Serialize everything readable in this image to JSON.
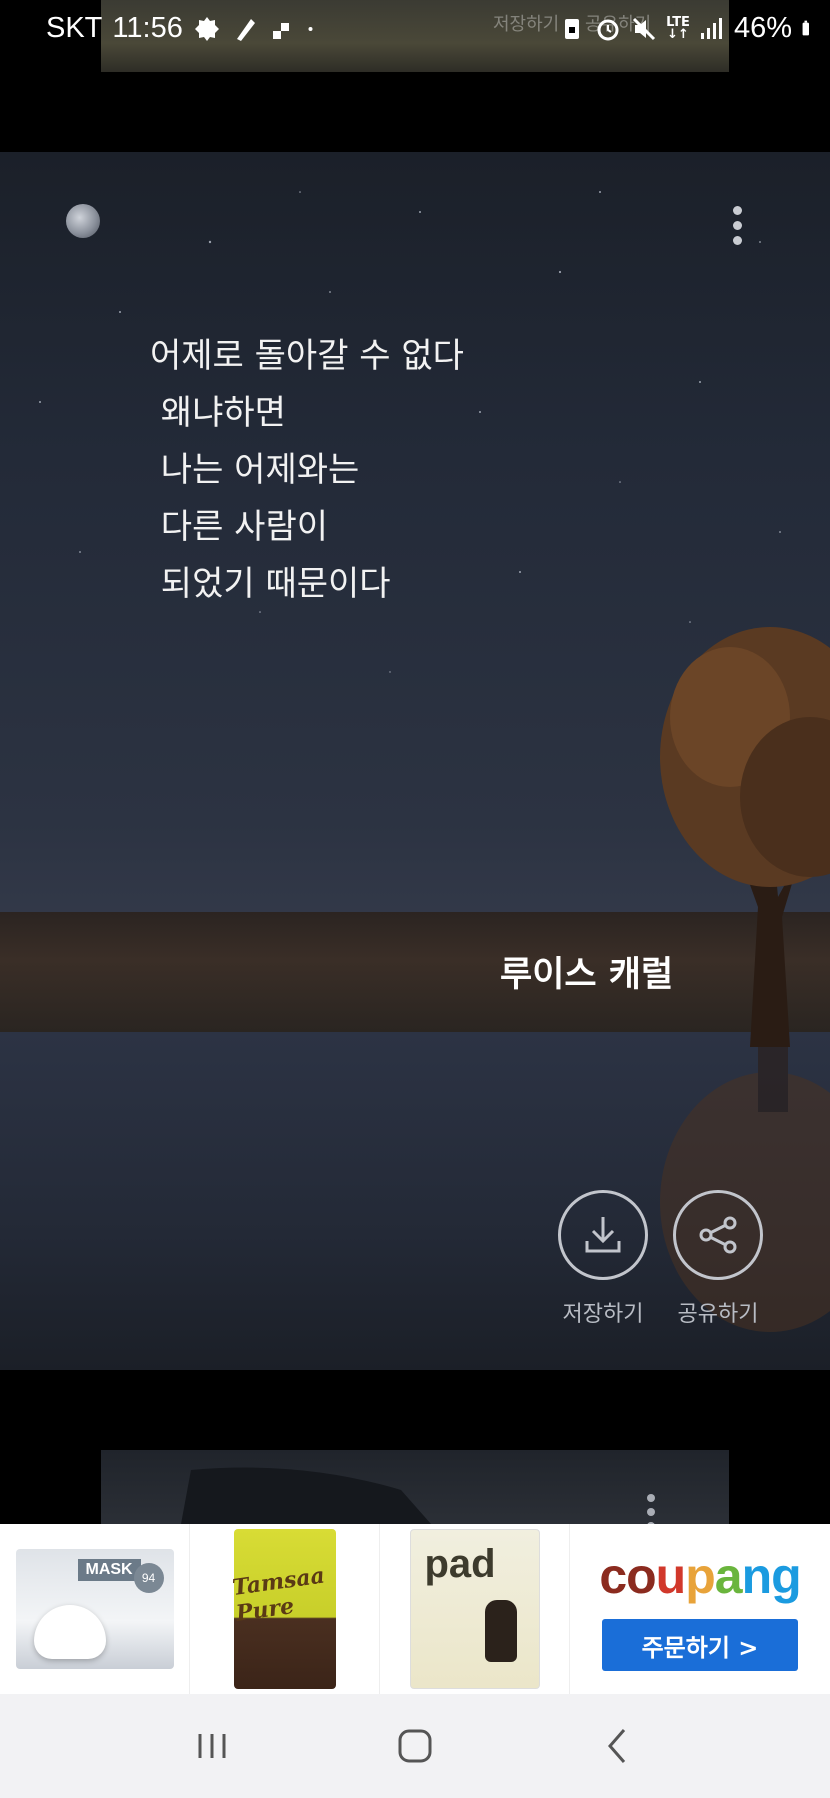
{
  "status_bar": {
    "carrier": "SKT",
    "time": "11:56",
    "network": "LTE",
    "battery": "46%",
    "ghost_text": [
      "저장하기",
      "공유하기"
    ]
  },
  "card": {
    "quote_lines": [
      "어제로 돌아갈 수 없다",
      " 왜냐하면",
      " 나는 어제와는",
      " 다른 사람이",
      " 되었기 때문이다"
    ],
    "author": "루이스 캐럴",
    "actions": {
      "save_label": "저장하기",
      "share_label": "공유하기"
    },
    "icons": {
      "moon": "moon-icon",
      "menu": "more-vert-icon",
      "save": "download-icon",
      "share": "share-icon"
    }
  },
  "ad": {
    "products": [
      {
        "name": "MASK",
        "badge": "94"
      },
      {
        "name": "Tamsaa Pure"
      },
      {
        "name": "pad"
      }
    ],
    "brand": "coupang",
    "order_button": "주문하기 >",
    "colors": {
      "order_button": "#1a6ed8"
    }
  },
  "nav": {
    "icons": [
      "recent-apps-icon",
      "home-icon",
      "back-icon"
    ]
  }
}
